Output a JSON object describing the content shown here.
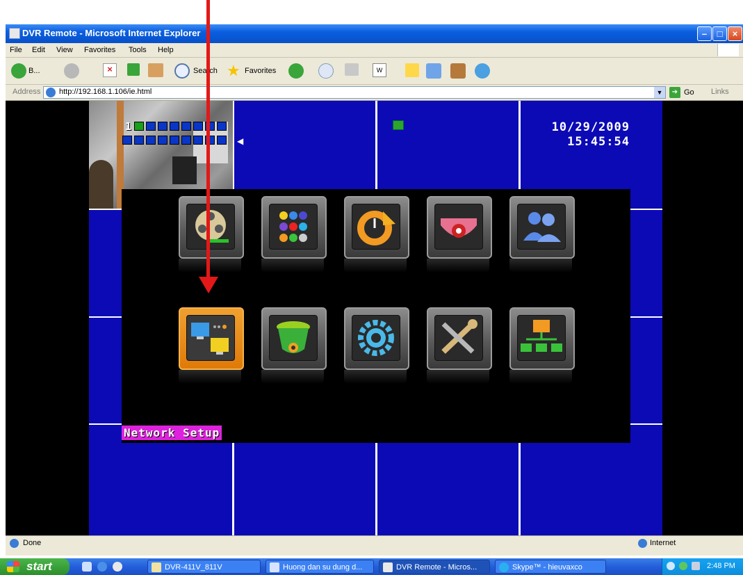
{
  "window": {
    "title": "DVR Remote - Microsoft Internet Explorer"
  },
  "menubar": [
    "File",
    "Edit",
    "View",
    "Favorites",
    "Tools",
    "Help"
  ],
  "toolbar": {
    "back_label": "B...",
    "search_label": "Search",
    "favorites_label": "Favorites"
  },
  "address": {
    "label": "Address",
    "url": "http://192.168.1.106/ie.html",
    "go_label": "Go",
    "links_label": "Links"
  },
  "dvr": {
    "channel_number": "1",
    "date": "10/29/2009",
    "time": "15:45:54",
    "selected_caption": "Network Setup",
    "menu_icons": [
      "playback-icon",
      "channel-grid-icon",
      "schedule-icon",
      "camera-dome-icon",
      "users-icon",
      "network-setup-icon",
      "ptz-camera-icon",
      "settings-gear-icon",
      "tools-icon",
      "network-tree-icon"
    ]
  },
  "statusbar": {
    "status": "Done",
    "zone": "Internet"
  },
  "taskbar": {
    "start_label": "start",
    "tasks": [
      {
        "label": "DVR-411V_811V"
      },
      {
        "label": "Huong dan su dung d..."
      },
      {
        "label": "DVR Remote - Micros..."
      },
      {
        "label": "Skype™ - hieuvaxco"
      }
    ],
    "clock": "2:48 PM"
  },
  "colors": {
    "dvr_background": "#0c0ab5",
    "caption_bg": "#dd22dd",
    "arrow": "#e31818",
    "selected_tile": "#e07a08"
  }
}
